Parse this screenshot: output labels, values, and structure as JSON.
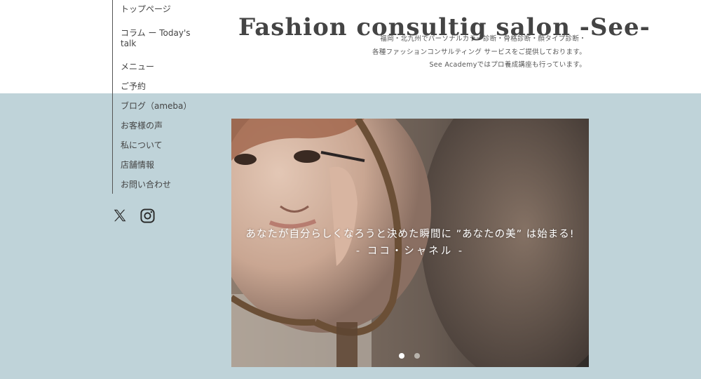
{
  "site": {
    "title": "Fashion consultig salon -See-",
    "description_lines": [
      "福岡・北九州でパーソナルカラー診断・骨格診断・顔タイプ診断・",
      "各種ファッションコンサルティング サービスをご提供しております。",
      "See Academyではプロ養成講座も行っています。"
    ]
  },
  "nav": {
    "items": [
      {
        "label": "トップページ"
      },
      {
        "label": "コラム ー Today's talk"
      },
      {
        "label": "メニュー"
      },
      {
        "label": "ご予約"
      },
      {
        "label": "ブログ（ameba）"
      },
      {
        "label": "お客様の声"
      },
      {
        "label": "私について"
      },
      {
        "label": "店舗情報"
      },
      {
        "label": "お問い合わせ"
      }
    ]
  },
  "social": {
    "icons": [
      "x-icon",
      "instagram-icon"
    ]
  },
  "hero": {
    "quote": "あなたが自分らしくなろうと決めた瞬間に ”あなたの美” は始まる!",
    "author": "- ココ・シャネル -",
    "slide_count": 2,
    "active_slide": 1
  },
  "colors": {
    "band": "#bfd3d9",
    "text": "#444444",
    "dot_active": "#ffffff",
    "dot_inactive": "#b8b3ac"
  }
}
